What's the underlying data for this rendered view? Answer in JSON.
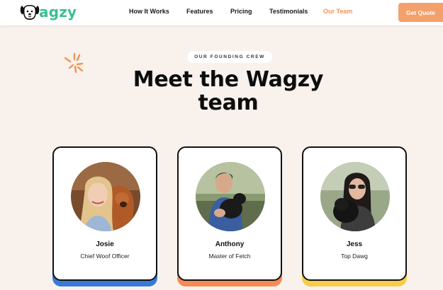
{
  "brand": {
    "name": "agzy",
    "logo_icon": "dog-head-icon",
    "logo_color": "#3bbf8e"
  },
  "nav": {
    "links": [
      {
        "label": "How It Works"
      },
      {
        "label": "Features"
      },
      {
        "label": "Pricing"
      },
      {
        "label": "Testimonials"
      },
      {
        "label": "Our Team",
        "active": true
      }
    ],
    "cta_label": "Get Quote"
  },
  "hero": {
    "eyebrow": "OUR FOUNDING CREW",
    "heading_line1": "Meet the Wagzy",
    "heading_line2": "team",
    "decoration_icon": "sparkle-icon"
  },
  "team": [
    {
      "name": "Josie",
      "role": "Chief Woof Officer",
      "accent": "#3a79d6"
    },
    {
      "name": "Anthony",
      "role": "Master of Fetch",
      "accent": "#f58a55"
    },
    {
      "name": "Jess",
      "role": "Top Dawg",
      "accent": "#f7cc4a"
    }
  ],
  "colors": {
    "background": "#f8f1ec",
    "accent_orange": "#f4924f",
    "cta": "#f4a06a"
  }
}
